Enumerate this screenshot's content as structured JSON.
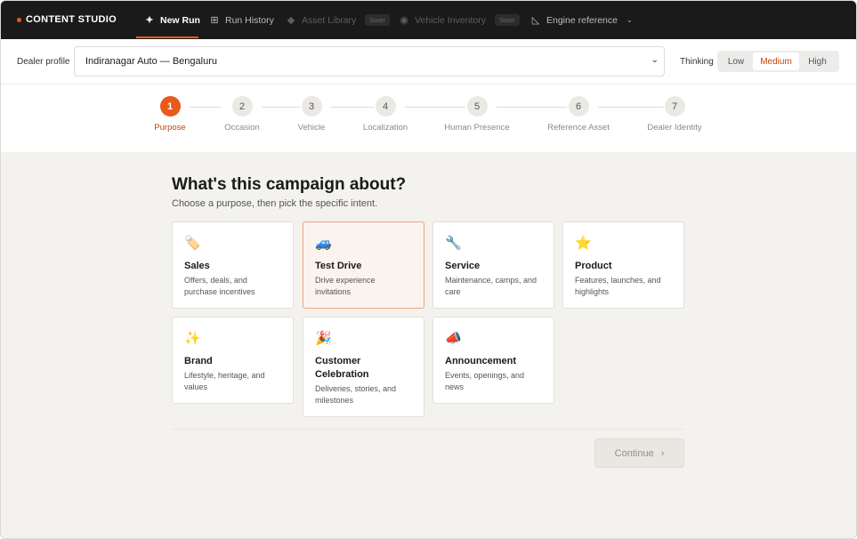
{
  "app": {
    "brand": "CONTENT STUDIO"
  },
  "nav": {
    "new_run": "New Run",
    "run_history": "Run History",
    "asset_library": "Asset Library",
    "asset_library_badge": "Soon",
    "vehicle_inventory": "Vehicle Inventory",
    "vehicle_inventory_badge": "Soon",
    "engine_reference": "Engine reference"
  },
  "dealer": {
    "label": "Dealer profile",
    "selected": "Indiranagar Auto — Bengaluru"
  },
  "thinking": {
    "label": "Thinking",
    "options": [
      "Low",
      "Medium",
      "High"
    ],
    "selected": "Medium"
  },
  "steps": [
    {
      "num": "1",
      "label": "Purpose",
      "active": true
    },
    {
      "num": "2",
      "label": "Occasion",
      "active": false
    },
    {
      "num": "3",
      "label": "Vehicle",
      "active": false
    },
    {
      "num": "4",
      "label": "Localization",
      "active": false
    },
    {
      "num": "5",
      "label": "Human Presence",
      "active": false
    },
    {
      "num": "6",
      "label": "Reference Asset",
      "active": false
    },
    {
      "num": "7",
      "label": "Dealer Identity",
      "active": false
    }
  ],
  "main": {
    "heading": "What's this campaign about?",
    "subheading": "Choose a purpose, then pick the specific intent.",
    "cards": [
      {
        "icon": "tag-icon",
        "glyph": "🏷️",
        "title": "Sales",
        "desc": "Offers, deals, and purchase incentives",
        "selected": false
      },
      {
        "icon": "car-icon",
        "glyph": "🚙",
        "title": "Test Drive",
        "desc": "Drive experience invitations",
        "selected": true
      },
      {
        "icon": "wrench-icon",
        "glyph": "🔧",
        "title": "Service",
        "desc": "Maintenance, camps, and care",
        "selected": false
      },
      {
        "icon": "star-icon",
        "glyph": "⭐",
        "title": "Product",
        "desc": "Features, launches, and highlights",
        "selected": false
      },
      {
        "icon": "sparkles-icon",
        "glyph": "✨",
        "title": "Brand",
        "desc": "Lifestyle, heritage, and values",
        "selected": false
      },
      {
        "icon": "party-popper-icon",
        "glyph": "🎉",
        "title": "Customer Celebration",
        "desc": "Deliveries, stories, and milestones",
        "selected": false
      },
      {
        "icon": "megaphone-icon",
        "glyph": "📣",
        "title": "Announcement",
        "desc": "Events, openings, and news",
        "selected": false
      }
    ],
    "continue_label": "Continue"
  },
  "colors": {
    "accent": "#e8591a",
    "topbar": "#1a1a1a",
    "background": "#f3f2ee",
    "selected_card": "#fbf3ee"
  }
}
